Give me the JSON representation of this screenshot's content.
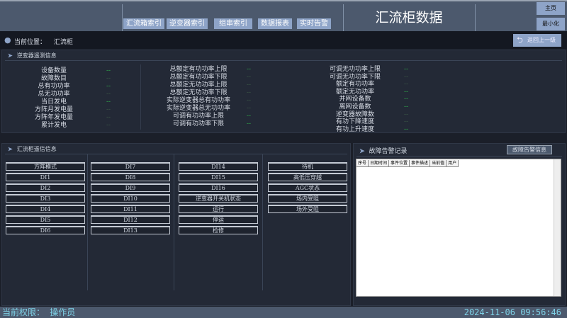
{
  "header": {
    "nav": [
      "汇流箱索引",
      "逆变器索引",
      "组串索引",
      "数据报表",
      "实时告警"
    ],
    "title": "汇流柜数据",
    "home": "主页",
    "minimize": "最小化"
  },
  "location": {
    "label": "当前位置：",
    "value": "汇流柜",
    "back": "返回上一级"
  },
  "telemetry": {
    "title": "逆变器遥测信息",
    "col1": [
      {
        "label": "设备数量",
        "value": "--"
      },
      {
        "label": "故障数目",
        "value": "--"
      },
      {
        "label": "总有功功率",
        "value": "--"
      },
      {
        "label": "总无功功率",
        "value": "--"
      },
      {
        "label": "当日发电",
        "value": "--"
      },
      {
        "label": "方阵月发电量",
        "value": "--"
      },
      {
        "label": "方阵年发电量",
        "value": "--"
      },
      {
        "label": "累计发电",
        "value": "--"
      }
    ],
    "col2": [
      {
        "label": "总额定有功功率上限",
        "value": "--"
      },
      {
        "label": "总额定有功功率下限",
        "value": "--"
      },
      {
        "label": "总额定无功功率上限",
        "value": "--"
      },
      {
        "label": "总额定无功功率下限",
        "value": "--"
      },
      {
        "label": "实际逆变器总有功功率",
        "value": "--"
      },
      {
        "label": "实际逆变器总无功功率",
        "value": "--"
      },
      {
        "label": "可调有功功率上限",
        "value": "--"
      },
      {
        "label": "可调有功功率下限",
        "value": "--"
      }
    ],
    "col3": [
      {
        "label": "可调无功功率上限",
        "value": "--"
      },
      {
        "label": "可调无功功率下限",
        "value": "--"
      },
      {
        "label": "额定有功功率",
        "value": "--"
      },
      {
        "label": "额定无功功率",
        "value": "--"
      },
      {
        "label": "并网设备数",
        "value": "--"
      },
      {
        "label": "离网设备数",
        "value": "--"
      },
      {
        "label": "逆变器故障数",
        "value": "--"
      },
      {
        "label": "有功下降速度",
        "value": "--"
      },
      {
        "label": "有功上升速度",
        "value": "--"
      }
    ]
  },
  "signals": {
    "title": "汇流柜遥信信息",
    "columns": [
      [
        "方阵模式",
        "DI1",
        "DI2",
        "DI3",
        "DI4",
        "DI5",
        "DI6"
      ],
      [
        "DI7",
        "DI8",
        "DI9",
        "DI10",
        "DI11",
        "DI12",
        "DI13"
      ],
      [
        "DI14",
        "DI15",
        "DI16",
        "逆变器开关机状态",
        "运行",
        "停运",
        "检修"
      ],
      [
        "待机",
        "高低压穿越",
        "AGC状态",
        "场内受阻",
        "场外受阻"
      ]
    ]
  },
  "alarms": {
    "title": "故障告警记录",
    "button": "故障告警信息",
    "columns": [
      "序号",
      "日期时间",
      "事件位置",
      "事件描述",
      "当前值",
      "用户"
    ]
  },
  "status": {
    "permission": "当前权限： 操作员",
    "datetime": "2024-11-06 09:56:46"
  }
}
